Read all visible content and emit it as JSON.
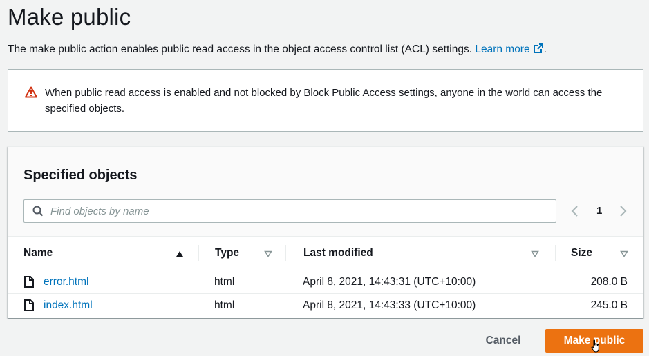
{
  "page": {
    "title": "Make public",
    "description": "The make public action enables public read access in the object access control list (ACL) settings.",
    "learn_more": "Learn more"
  },
  "alert": {
    "icon": "warning-triangle-icon",
    "text": "When public read access is enabled and not blocked by Block Public Access settings, anyone in the world can access the specified objects."
  },
  "objects_panel": {
    "title": "Specified objects",
    "search_placeholder": "Find objects by name",
    "search_value": "",
    "page_number": "1",
    "columns": [
      "Name",
      "Type",
      "Last modified",
      "Size"
    ],
    "rows": [
      {
        "name": "error.html",
        "type": "html",
        "last_modified": "April 8, 2021, 14:43:31 (UTC+10:00)",
        "size": "208.0 B"
      },
      {
        "name": "index.html",
        "type": "html",
        "last_modified": "April 8, 2021, 14:43:33 (UTC+10:00)",
        "size": "245.0 B"
      }
    ]
  },
  "footer": {
    "cancel_label": "Cancel",
    "primary_label": "Make public"
  },
  "colors": {
    "primary_button": "#ec7211",
    "link": "#0073bb",
    "warning": "#d13212"
  }
}
